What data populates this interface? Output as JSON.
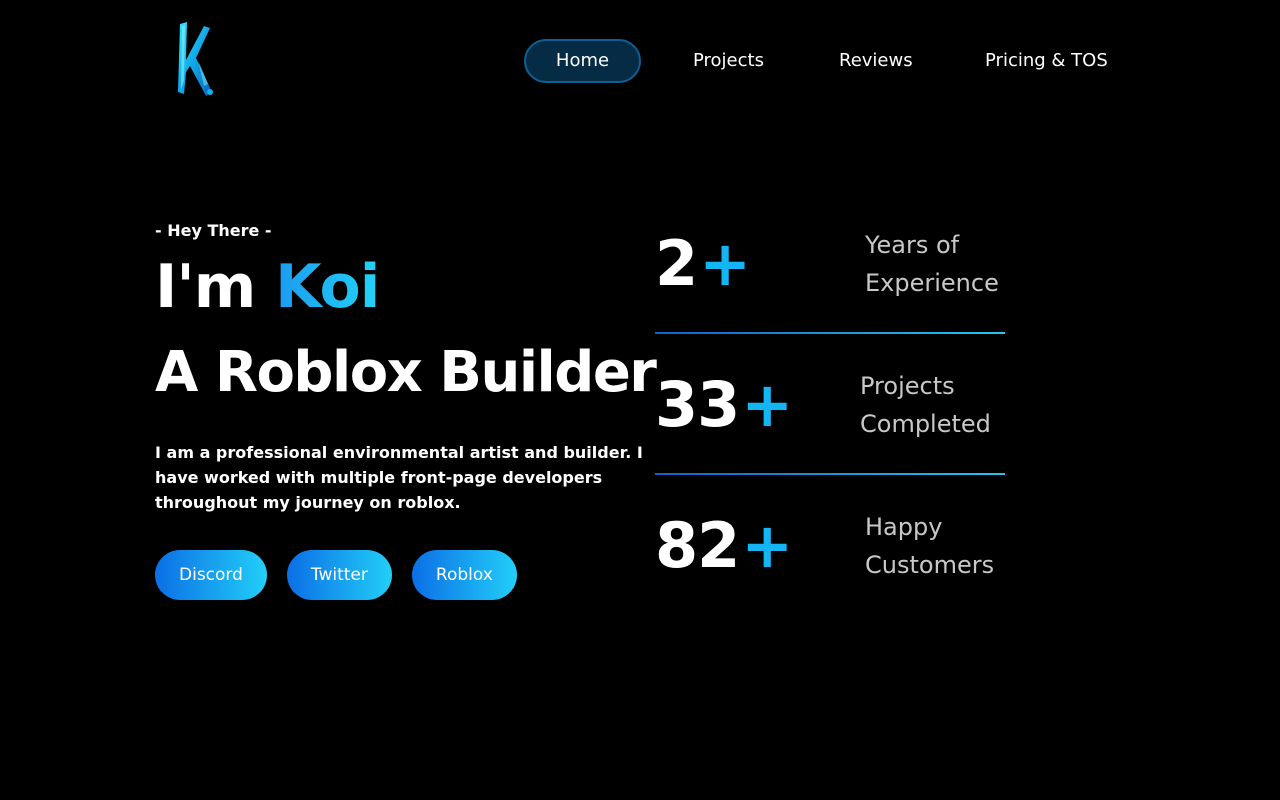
{
  "logo": {
    "letter": "K",
    "icon": "k-logo-icon"
  },
  "nav": {
    "items": [
      {
        "label": "Home",
        "active": true
      },
      {
        "label": "Projects",
        "active": false
      },
      {
        "label": "Reviews",
        "active": false
      },
      {
        "label": "Pricing & TOS",
        "active": false
      }
    ]
  },
  "hero": {
    "greeting": "- Hey There -",
    "intro_prefix": "I'm",
    "name": "Koi",
    "role": "A Roblox Builder",
    "bio": "I am a professional environmental artist and builder. I have worked with multiple front-page developers throughout my journey on roblox.",
    "buttons": [
      {
        "label": "Discord"
      },
      {
        "label": "Twitter"
      },
      {
        "label": "Roblox"
      }
    ]
  },
  "stats": [
    {
      "value": "2",
      "suffix": "+",
      "label": "Years of Experience"
    },
    {
      "value": "33",
      "suffix": "+",
      "label": "Projects Completed"
    },
    {
      "value": "82",
      "suffix": "+",
      "label": "Happy Customers"
    }
  ],
  "colors": {
    "background": "#000000",
    "accent": "#13b5f2",
    "accent_gradient_start": "#0b6fe6",
    "accent_gradient_end": "#22cff8",
    "nav_active_bg": "#062b44",
    "nav_active_border": "#0e5f94",
    "label_grey": "#c8c8c8"
  }
}
